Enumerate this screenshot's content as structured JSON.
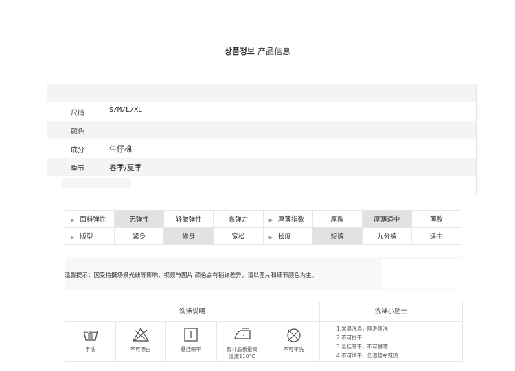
{
  "title": {
    "main": "상품정보",
    "sub": "产品信息"
  },
  "info": {
    "rows": [
      {
        "key": "尺码",
        "value": "S/M/L/XL"
      },
      {
        "key": "颜色",
        "value": ""
      },
      {
        "key": "成分",
        "value": "牛仔棉"
      },
      {
        "key": "季节",
        "value": "春季/夏季"
      }
    ]
  },
  "attributes": {
    "row1": {
      "label": "面料弹性",
      "options": [
        "无弹性",
        "轻微弹性",
        "高弹力"
      ],
      "label2": "厚薄指数",
      "options2": [
        "厚款",
        "厚薄适中",
        "薄款"
      ]
    },
    "row2": {
      "label": "版型",
      "options": [
        "紧身",
        "修身",
        "宽松"
      ],
      "label2": "长度",
      "options2": [
        "短裤",
        "九分裤",
        "适中"
      ]
    },
    "selected": [
      "无弹性",
      "厚薄适中",
      "修身",
      "短裤"
    ]
  },
  "tip": {
    "text": "温馨提示：因受拍摄场景光线等影响，视频与图片  颜色会有稍许差异，请以图片和细节颜色为主。"
  },
  "wash": {
    "heading": "洗涤说明",
    "tips_heading": "洗涤小贴士",
    "icons": [
      {
        "icon": "hand-wash-icon",
        "caption": "手洗"
      },
      {
        "icon": "no-bleach-icon",
        "caption": "不可漂白"
      },
      {
        "icon": "hang-dry-icon",
        "caption": "悬挂晾干"
      },
      {
        "icon": "iron-icon",
        "caption": "熨斗底板最高",
        "caption2": "温度110°C"
      },
      {
        "icon": "no-dry-clean-icon",
        "caption": "不可干洗"
      }
    ],
    "tips": [
      "1.常温洗涤，随洗随洗",
      "2.不可拧干",
      "3.悬挂晾干，不可暴晒",
      "4.不可烘干、低温垫布熨烫"
    ]
  }
}
